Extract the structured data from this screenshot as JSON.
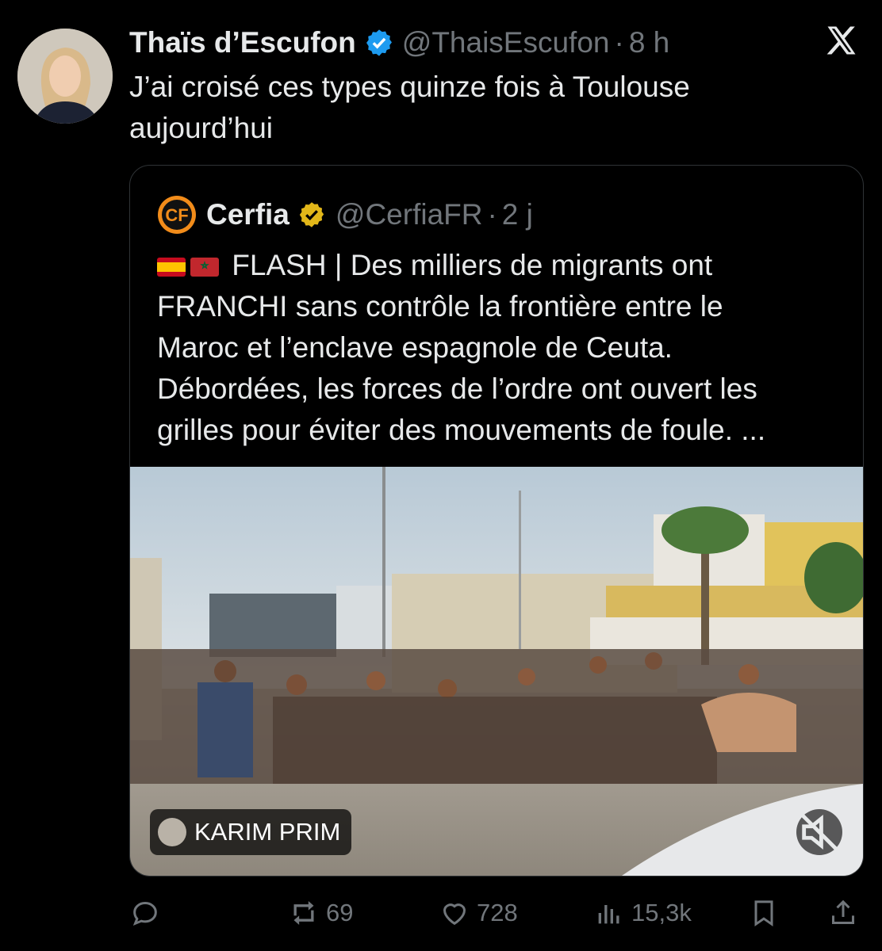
{
  "tweet": {
    "author_name": "Thaïs d’Escufon",
    "handle": "@ThaisEscufon",
    "separator": "·",
    "time": "8 h",
    "text_lines": [
      "J’ai croisé ces types quinze fois à Toulouse",
      "aujourd’hui"
    ]
  },
  "quote": {
    "author_name": "Cerfia",
    "handle": "@CerfiaFR",
    "separator": "·",
    "time": "2 j",
    "text_lines": [
      "FLASH | Des milliers de migrants ont",
      "FRANCHI sans contrôle la frontière entre le",
      "Maroc et l’enclave espagnole de Ceuta.",
      "Débordées, les forces de l’ordre ont ouvert les",
      "grilles pour éviter des mouvements de foule. ..."
    ],
    "flags": [
      "flag-spain-icon",
      "flag-morocco-icon"
    ],
    "media_credit": "KARIM PRIM"
  },
  "actions": {
    "reply_count": "",
    "retweet_count": "69",
    "like_count": "728",
    "views_count": "15,3k"
  },
  "colors": {
    "background": "#000000",
    "text": "#e7e9ea",
    "secondary": "#71767b",
    "verified_blue": "#1d9bf0",
    "verified_gold": "#e2b719",
    "border": "#2f3336"
  }
}
